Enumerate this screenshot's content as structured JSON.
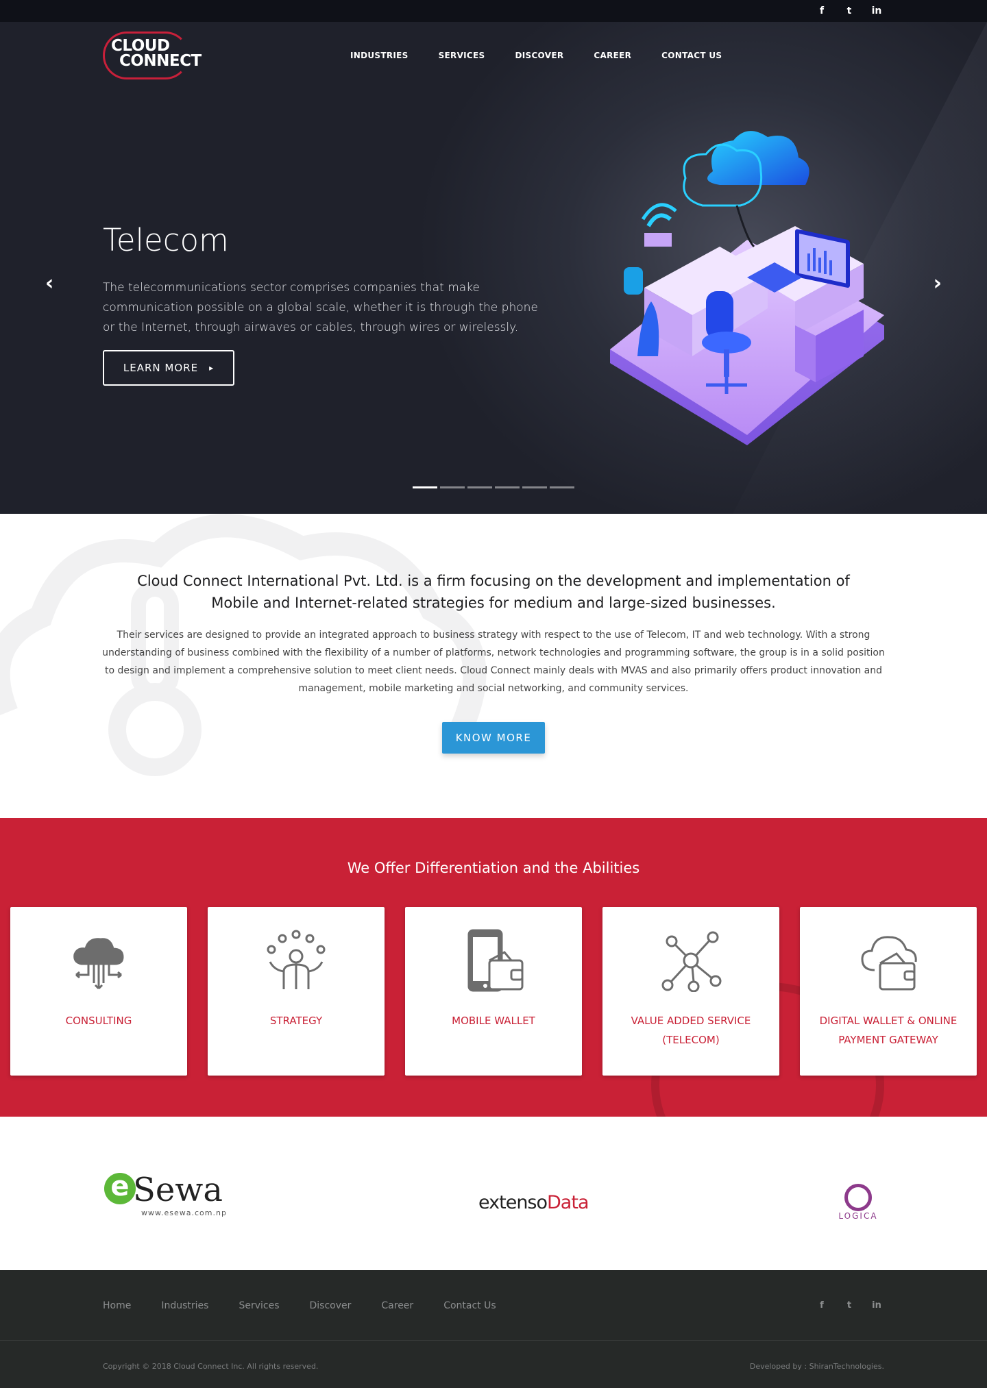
{
  "top_social": [
    {
      "icon": "facebook-icon",
      "glyph": "f"
    },
    {
      "icon": "twitter-icon",
      "glyph": "t"
    },
    {
      "icon": "linkedin-icon",
      "glyph": "in"
    }
  ],
  "logo": {
    "line1": "CLOUD",
    "line2": "CONNECT"
  },
  "nav": [
    "INDUSTRIES",
    "SERVICES",
    "DISCOVER",
    "CAREER",
    "CONTACT US"
  ],
  "hero": {
    "title": "Telecom",
    "description": "The telecommunications sector comprises companies that make communication possible on a global scale, whether it is through the phone or the Internet, through airwaves or cables, through wires or wirelessly.",
    "button_label": "LEARN MORE",
    "slide_count": 6,
    "active_slide": 1,
    "prev_glyph": "‹",
    "next_glyph": "›",
    "button_glyph": "▸"
  },
  "about": {
    "heading": "Cloud Connect International Pvt. Ltd. is a firm focusing on the development and implementation of Mobile and Internet-related strategies for medium and large-sized businesses.",
    "text": "Their services are designed to provide an integrated approach to business strategy with respect to the use of Telecom, IT and web technology. With a strong understanding of business combined with the flexibility of a number of platforms, network technologies and programming software, the group is in a solid position to design and implement a comprehensive solution to meet client needs. Cloud Connect mainly deals with MVAS and also primarily offers product innovation and management, mobile marketing and social networking, and community services.",
    "button_label": "KNOW MORE"
  },
  "offer": {
    "title": "We Offer Differentiation and the Abilities",
    "cards": [
      {
        "label": "CONSULTING",
        "icon": "cloud-network-icon"
      },
      {
        "label": "STRATEGY",
        "icon": "juggler-icon"
      },
      {
        "label": "MOBILE WALLET",
        "icon": "phone-wallet-icon"
      },
      {
        "label": "VALUE ADDED SERVICE (TELECOM)",
        "icon": "network-nodes-icon"
      },
      {
        "label": "DIGITAL WALLET & ONLINE PAYMENT GATEWAY",
        "icon": "cloud-wallet-icon"
      }
    ]
  },
  "partners": {
    "esewa": {
      "e": "e",
      "name": "Sewa",
      "url": "www.esewa.com.np"
    },
    "extenso": {
      "part1": "extenso",
      "part2": "Data"
    },
    "logica": {
      "name": "LOGICA"
    }
  },
  "footer": {
    "nav": [
      "Home",
      "Industries",
      "Services",
      "Discover",
      "Career",
      "Contact Us"
    ],
    "social": [
      {
        "icon": "facebook-icon",
        "glyph": "f"
      },
      {
        "icon": "twitter-icon",
        "glyph": "t"
      },
      {
        "icon": "linkedin-icon",
        "glyph": "in"
      }
    ],
    "copyright": "Copyright © 2018 Cloud Connect Inc. All rights reserved.",
    "developed": "Developed by : ShiranTechnologies."
  },
  "colors": {
    "brand_red": "#c92136",
    "accent_blue": "#2b96d6",
    "footer_bg": "#262928",
    "hero_bg": "#2b2e3a"
  }
}
